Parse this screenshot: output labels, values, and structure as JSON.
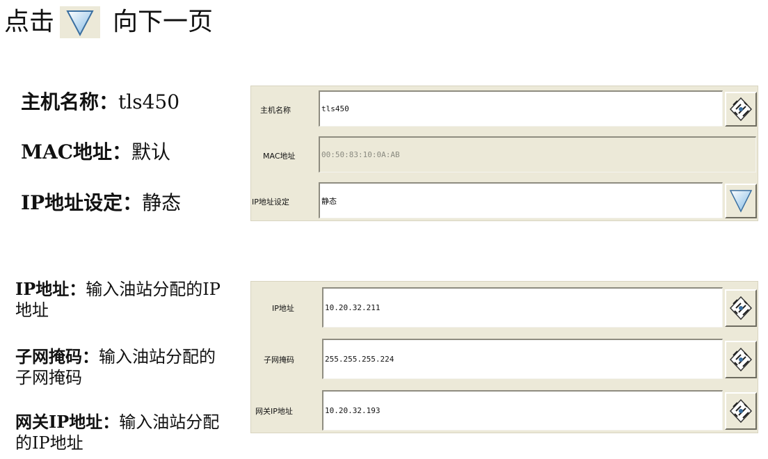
{
  "heading": {
    "prefix": "点击",
    "suffix": "向下一页",
    "icon": "down-triangle-icon"
  },
  "descriptions_top": [
    {
      "label": "主机名称：",
      "value": "tls450"
    },
    {
      "label": "MAC地址：",
      "value": "默认"
    },
    {
      "label": "IP地址设定：",
      "value": "静态"
    }
  ],
  "descriptions_bottom": [
    {
      "label": "IP地址：",
      "value": "输入油站分配的IP地址"
    },
    {
      "label": "子网掩码：",
      "value": "输入油站分配的子网掩码"
    },
    {
      "label": "网关IP地址：",
      "value": "输入油站分配的IP地址"
    }
  ],
  "panel_top": {
    "hostname": {
      "label": "主机名称",
      "value": "tls450",
      "button_icon": "keyboard-icon"
    },
    "mac": {
      "label": "MAC地址",
      "value": "00:50:83:10:0A:AB"
    },
    "ip_mode": {
      "label": "IP地址设定",
      "value": "静态",
      "button_icon": "dropdown-triangle-icon"
    }
  },
  "panel_bottom": {
    "ip": {
      "label": "IP地址",
      "value": "10.20.32.211",
      "button_icon": "keyboard-icon"
    },
    "subnet": {
      "label": "子网掩码",
      "value": "255.255.255.224",
      "button_icon": "keyboard-icon"
    },
    "gateway": {
      "label": "网关IP地址",
      "value": "10.20.32.193",
      "button_icon": "keyboard-icon"
    }
  },
  "colors": {
    "panel_bg": "#ece9d8",
    "triangle_fill": "#9cc9ec"
  }
}
